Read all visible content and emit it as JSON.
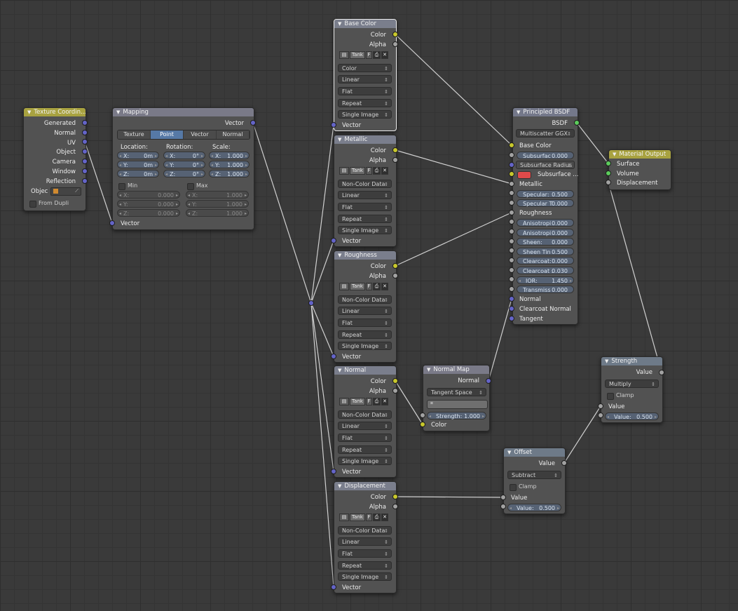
{
  "colors": {
    "wire": "#d0d0d0",
    "socket_color": "#c8c82c",
    "socket_float": "#a2a2a2",
    "socket_vector": "#6464c8",
    "socket_shader": "#5ccc5c",
    "accent_tab": "#5679a6",
    "output_header": "#a8a240"
  },
  "texcoord": {
    "title": "Texture Coordin...",
    "outputs": [
      "Generated",
      "Normal",
      "UV",
      "Object",
      "Camera",
      "Window",
      "Reflection"
    ],
    "object_label": "Objec",
    "from_dupli": "From Dupli"
  },
  "mapping": {
    "title": "Mapping",
    "output": "Vector",
    "tabs": [
      "Texture",
      "Point",
      "Vector",
      "Normal"
    ],
    "active_tab": "Point",
    "location_label": "Location:",
    "rotation_label": "Rotation:",
    "scale_label": "Scale:",
    "loc": [
      [
        "X:",
        "0m"
      ],
      [
        "Y:",
        "0m"
      ],
      [
        "Z:",
        "0m"
      ]
    ],
    "rot": [
      [
        "X:",
        "0°"
      ],
      [
        "Y:",
        "0°"
      ],
      [
        "Z:",
        "0°"
      ]
    ],
    "scale": [
      [
        "X:",
        "1.000"
      ],
      [
        "Y:",
        "1.000"
      ],
      [
        "Z:",
        "1.000"
      ]
    ],
    "min_label": "Min",
    "max_label": "Max",
    "min": [
      [
        "X:",
        "0.000"
      ],
      [
        "Y:",
        "0.000"
      ],
      [
        "Z:",
        "0.000"
      ]
    ],
    "max": [
      [
        "X:",
        "1.000"
      ],
      [
        "Y:",
        "1.000"
      ],
      [
        "Z:",
        "1.000"
      ]
    ],
    "input": "Vector"
  },
  "image_nodes": [
    {
      "title": "Base Color",
      "out_color": "Color",
      "out_alpha": "Alpha",
      "image": "Tank",
      "opt": [
        "Color",
        "Linear",
        "Flat",
        "Repeat",
        "Single Image"
      ],
      "input": "Vector"
    },
    {
      "title": "Metallic",
      "out_color": "Color",
      "out_alpha": "Alpha",
      "image": "Tank",
      "opt": [
        "Non-Color Data",
        "Linear",
        "Flat",
        "Repeat",
        "Single Image"
      ],
      "input": "Vector"
    },
    {
      "title": "Roughness",
      "out_color": "Color",
      "out_alpha": "Alpha",
      "image": "Tank",
      "opt": [
        "Non-Color Data",
        "Linear",
        "Flat",
        "Repeat",
        "Single Image"
      ],
      "input": "Vector"
    },
    {
      "title": "Normal",
      "out_color": "Color",
      "out_alpha": "Alpha",
      "image": "Tank",
      "opt": [
        "Non-Color Data",
        "Linear",
        "Flat",
        "Repeat",
        "Single Image"
      ],
      "input": "Vector"
    },
    {
      "title": "Displacement",
      "out_color": "Color",
      "out_alpha": "Alpha",
      "image": "Tank",
      "opt": [
        "Non-Color Data",
        "Linear",
        "Flat",
        "Repeat",
        "Single Image"
      ],
      "input": "Vector"
    }
  ],
  "image_btn": {
    "fake": "F",
    "close": "✕"
  },
  "principled": {
    "title": "Principled BSDF",
    "output": "BSDF",
    "distribution": "Multiscatter GGX",
    "base_color": "Base Color",
    "subsurface": [
      "Subsurfac",
      "0.000"
    ],
    "subsurface_radius": "Subsurface Radius",
    "subsurface_color": "Subsurface ...",
    "metallic": "Metallic",
    "specular": [
      "Specular:",
      "0.500"
    ],
    "specular_tint": [
      "Specular T",
      "0.000"
    ],
    "roughness": "Roughness",
    "anisotropic": [
      "Anisotropi",
      "0.000"
    ],
    "anisotropic_rot": [
      "Anisotropi",
      "0.000"
    ],
    "sheen": [
      "Sheen:",
      "0.000"
    ],
    "sheen_tint": [
      "Sheen Tin",
      "0.500"
    ],
    "clearcoat": [
      "Clearcoat:",
      "0.000"
    ],
    "clearcoat_rough": [
      "Clearcoat :",
      "0.030"
    ],
    "ior": [
      "IOR:",
      "1.450"
    ],
    "transmission": [
      "Transmiss",
      "0.000"
    ],
    "normal": "Normal",
    "clearcoat_normal": "Clearcoat Normal",
    "tangent": "Tangent"
  },
  "material_output": {
    "title": "Material Output",
    "inputs": [
      "Surface",
      "Volume",
      "Displacement"
    ]
  },
  "normal_map": {
    "title": "Normal Map",
    "output": "Normal",
    "space": "Tangent Space",
    "strength": [
      "Strength:",
      "1.000"
    ],
    "input": "Color"
  },
  "strength": {
    "title": "Strength",
    "output": "Value",
    "op": "Multiply",
    "clamp": "Clamp",
    "input": "Value",
    "value": [
      "Value:",
      "0.500"
    ]
  },
  "offset": {
    "title": "Offset",
    "output": "Value",
    "op": "Subtract",
    "clamp": "Clamp",
    "input": "Value",
    "value": [
      "Value:",
      "0.500"
    ]
  }
}
